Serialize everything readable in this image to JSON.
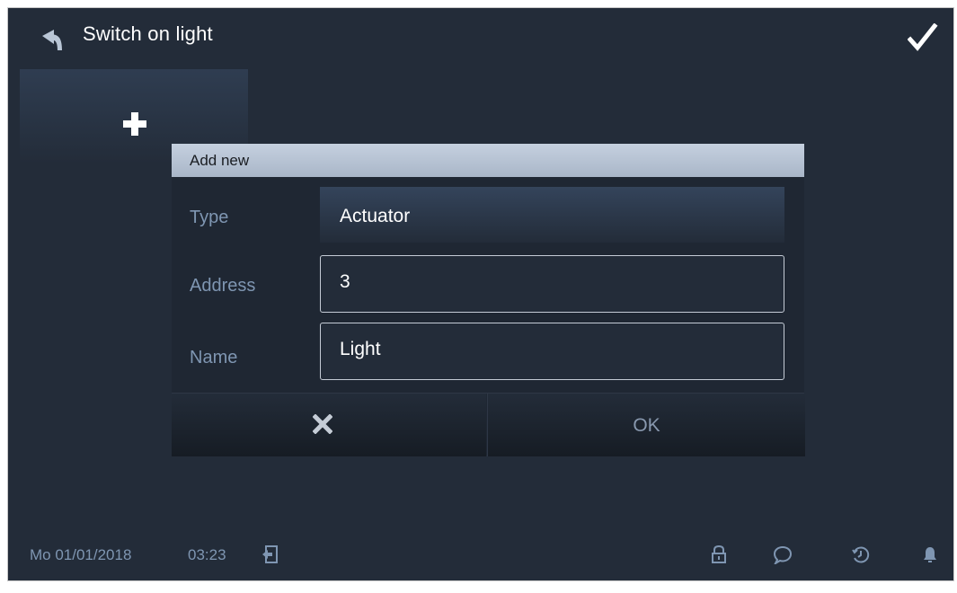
{
  "header": {
    "title": "Switch on light",
    "back_icon": "arrow-up-left-icon",
    "confirm_icon": "checkmark-icon"
  },
  "add_tile": {
    "icon": "plus-icon"
  },
  "dialog": {
    "title": "Add new",
    "fields": [
      {
        "label": "Type",
        "value": "Actuator"
      },
      {
        "label": "Address",
        "value": "3"
      },
      {
        "label": "Name",
        "value": "Light"
      }
    ],
    "cancel_icon": "x-icon",
    "ok_label": "OK"
  },
  "status_bar": {
    "date": "Mo 01/01/2018",
    "time": "03:23",
    "icons": [
      "door-exit-icon",
      "lock-icon",
      "chat-bubble-icon",
      "history-clock-icon",
      "bell-icon"
    ]
  },
  "colors": {
    "background": "#232c39",
    "header_bar": "#b9c5d6",
    "label": "#7f96b2",
    "text": "#ffffff"
  }
}
